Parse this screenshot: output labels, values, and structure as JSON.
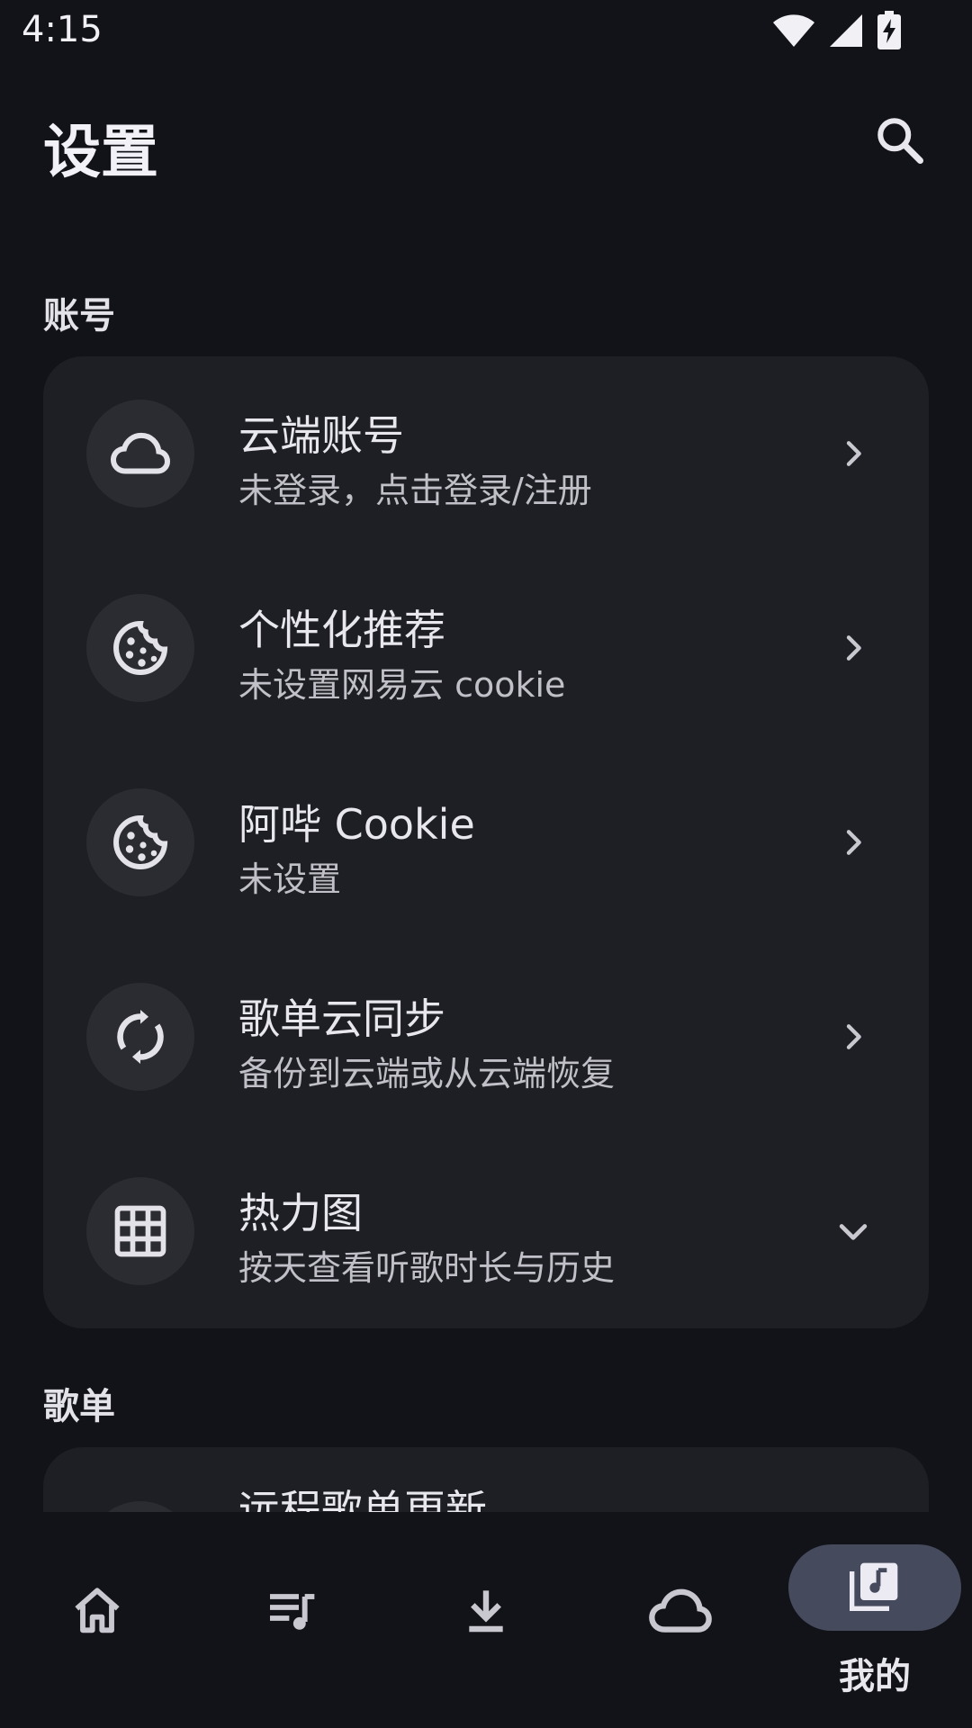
{
  "status": {
    "time": "4:15",
    "icons": [
      "wifi-icon",
      "signal-icon",
      "battery-charging-icon"
    ]
  },
  "header": {
    "title": "设置",
    "search_icon": "search-icon"
  },
  "sections": [
    {
      "label": "账号",
      "items": [
        {
          "title": "云端账号",
          "subtitle": "未登录，点击登录/注册",
          "icon": "cloud-icon",
          "trailing": "chevron-right-icon"
        },
        {
          "title": "个性化推荐",
          "subtitle": "未设置网易云 cookie",
          "icon": "cookie-icon",
          "trailing": "chevron-right-icon"
        },
        {
          "title": "阿哔 Cookie",
          "subtitle": "未设置",
          "icon": "cookie-icon",
          "trailing": "chevron-right-icon"
        },
        {
          "title": "歌单云同步",
          "subtitle": "备份到云端或从云端恢复",
          "icon": "sync-icon",
          "trailing": "chevron-right-icon"
        },
        {
          "title": "热力图",
          "subtitle": "按天查看听歌时长与历史",
          "icon": "grid-icon",
          "trailing": "chevron-down-icon"
        }
      ]
    },
    {
      "label": "歌单",
      "items": [
        {
          "title": "远程歌单更新"
        }
      ]
    }
  ],
  "bottom_nav": {
    "items": [
      {
        "icon": "home-icon"
      },
      {
        "icon": "playlist-icon"
      },
      {
        "icon": "download-icon"
      },
      {
        "icon": "cloud-icon"
      },
      {
        "icon": "library-music-icon",
        "label": "我的",
        "active": true
      }
    ]
  },
  "colors": {
    "background": "#121318",
    "card": "#1e1f25",
    "icon_bg": "#2b2c32",
    "active_pill": "#454a5c"
  }
}
